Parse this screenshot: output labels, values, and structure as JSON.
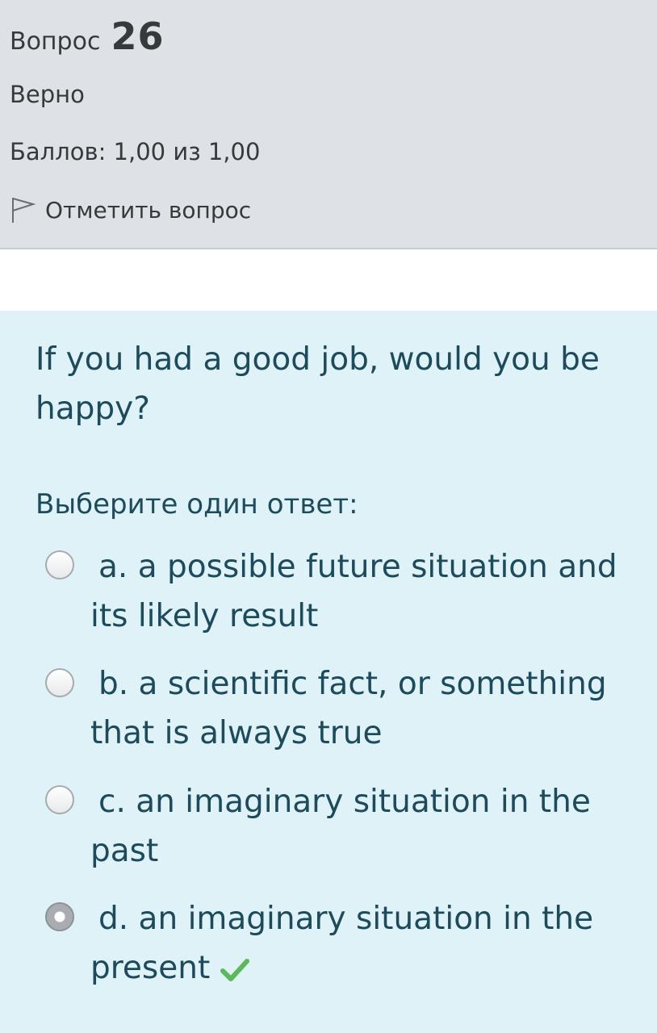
{
  "info": {
    "question_word": "Вопрос",
    "question_number": "26",
    "state": "Верно",
    "grade": "Баллов: 1,00 из 1,00",
    "flag_label": "Отметить вопрос",
    "flag_icon": "flag-icon"
  },
  "question": {
    "text": "If you had a good job, would you be happy?",
    "prompt": "Выберите один ответ:",
    "answers": [
      {
        "label": "a. a possible future situation and its likely result",
        "selected": false
      },
      {
        "label": "b. a scientific fact, or something that is always true",
        "selected": false
      },
      {
        "label": "c. an imaginary situation in the past",
        "selected": false
      },
      {
        "label": "d. an imaginary situation in the present",
        "selected": true,
        "correct": true
      }
    ],
    "correct_icon": "check-icon"
  },
  "colors": {
    "info_background": "#dee2e6",
    "content_background": "#def2f8",
    "text_primary": "#1d4b5c",
    "correct_check": "#5cb85c"
  }
}
